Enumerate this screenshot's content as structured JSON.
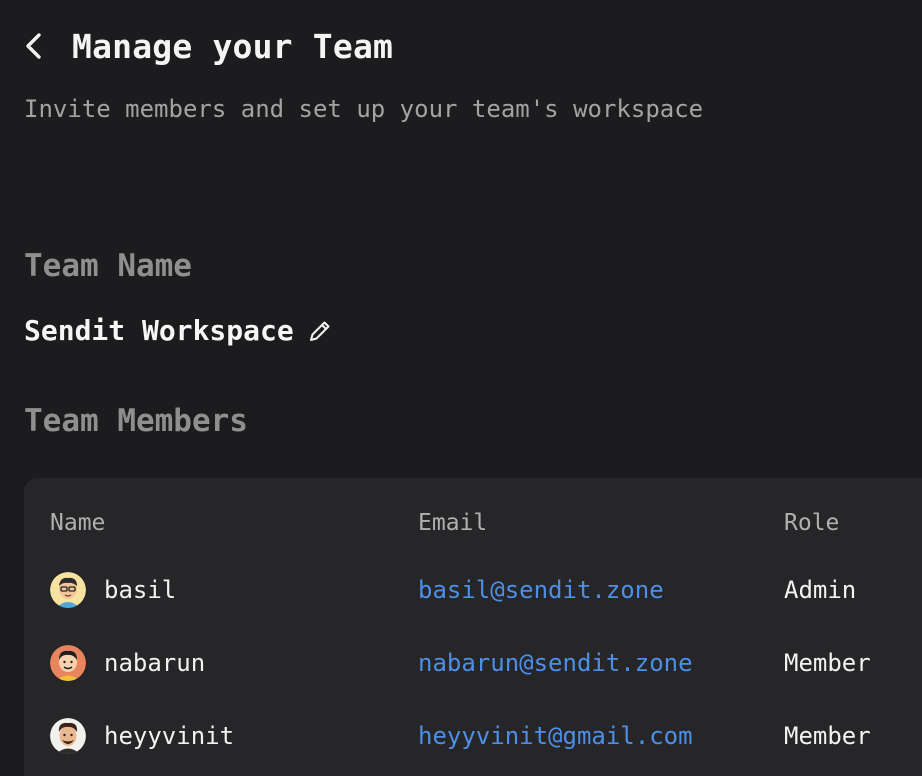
{
  "header": {
    "title": "Manage your Team",
    "subtitle": "Invite members and set up your team's workspace"
  },
  "team_name_section": {
    "label": "Team Name",
    "value": "Sendit Workspace"
  },
  "members_section": {
    "label": "Team Members",
    "columns": {
      "name": "Name",
      "email": "Email",
      "role": "Role"
    },
    "rows": [
      {
        "name": "basil",
        "email": "basil@sendit.zone",
        "role": "Admin",
        "avatar_bg": "#f7e2a0"
      },
      {
        "name": "nabarun",
        "email": "nabarun@sendit.zone",
        "role": "Member",
        "avatar_bg": "#e8845e"
      },
      {
        "name": "heyyvinit",
        "email": "heyyvinit@gmail.com",
        "role": "Member",
        "avatar_bg": "#f3f1ee"
      }
    ]
  },
  "colors": {
    "background": "#1c1c1e",
    "card": "#262628",
    "link": "#4d8fe6",
    "muted": "#8f8f8f"
  }
}
